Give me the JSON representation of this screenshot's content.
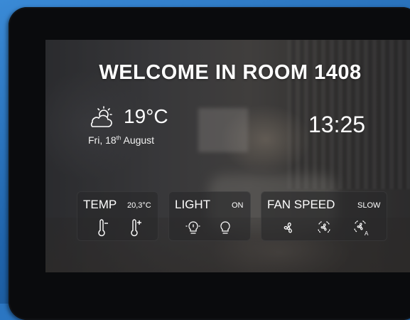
{
  "header": {
    "title": "WELCOME IN ROOM 1408"
  },
  "weather": {
    "icon": "partly-cloudy-sun-icon",
    "temperature": "19°C"
  },
  "date": {
    "day_prefix": "Fri, 18",
    "suffix": "th",
    "month": " August"
  },
  "clock": {
    "time": "13:25"
  },
  "controls": {
    "temp": {
      "label": "TEMP",
      "value": "20,3°C",
      "icons": [
        "thermometer-minus-icon",
        "thermometer-plus-icon"
      ]
    },
    "light": {
      "label": "LIGHT",
      "value": "ON",
      "icons": [
        "bulb-on-icon",
        "bulb-off-icon"
      ]
    },
    "fan": {
      "label": "FAN SPEED",
      "value": "SLOW",
      "icons": [
        "fan-icon",
        "fan-speed-icon",
        "fan-auto-icon"
      ]
    }
  },
  "colors": {
    "frame_blue": "#2b76c2",
    "bezel": "#0a0b0d",
    "text": "#ffffff"
  }
}
